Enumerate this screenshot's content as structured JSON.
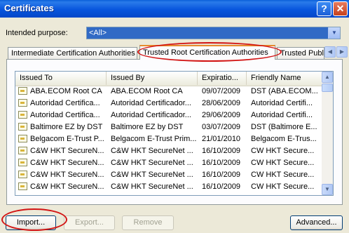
{
  "window": {
    "title": "Certificates",
    "help_label": "?",
    "close_label": "✕"
  },
  "purpose": {
    "label": "Intended purpose:",
    "value": "<All>"
  },
  "tabs": [
    {
      "label": "Intermediate Certification Authorities"
    },
    {
      "label": "Trusted Root Certification Authorities"
    },
    {
      "label": "Trusted Publishers"
    }
  ],
  "columns": [
    "Issued To",
    "Issued By",
    "Expiratio...",
    "Friendly Name"
  ],
  "rows": [
    [
      "ABA.ECOM Root CA",
      "ABA.ECOM Root CA",
      "09/07/2009",
      "DST (ABA.ECOM..."
    ],
    [
      "Autoridad Certifica...",
      "Autoridad Certificador...",
      "28/06/2009",
      "Autoridad Certifi..."
    ],
    [
      "Autoridad Certifica...",
      "Autoridad Certificador...",
      "29/06/2009",
      "Autoridad Certifi..."
    ],
    [
      "Baltimore EZ by DST",
      "Baltimore EZ by DST",
      "03/07/2009",
      "DST (Baltimore E..."
    ],
    [
      "Belgacom E-Trust P...",
      "Belgacom E-Trust Prim...",
      "21/01/2010",
      "Belgacom E-Trus..."
    ],
    [
      "C&W HKT SecureN...",
      "C&W HKT SecureNet ...",
      "16/10/2009",
      "CW HKT Secure..."
    ],
    [
      "C&W HKT SecureN...",
      "C&W HKT SecureNet ...",
      "16/10/2009",
      "CW HKT Secure..."
    ],
    [
      "C&W HKT SecureN...",
      "C&W HKT SecureNet ...",
      "16/10/2009",
      "CW HKT Secure..."
    ],
    [
      "C&W HKT SecureN...",
      "C&W HKT SecureNet ...",
      "16/10/2009",
      "CW HKT Secure..."
    ]
  ],
  "buttons": {
    "import": "Import...",
    "export": "Export...",
    "remove": "Remove",
    "advanced": "Advanced..."
  },
  "icons": {
    "certificate": "certificate-icon"
  },
  "colors": {
    "titlebar": "#0855DD",
    "highlight_oval": "#D21414",
    "selected_tab_accent": "#E68B2C"
  }
}
